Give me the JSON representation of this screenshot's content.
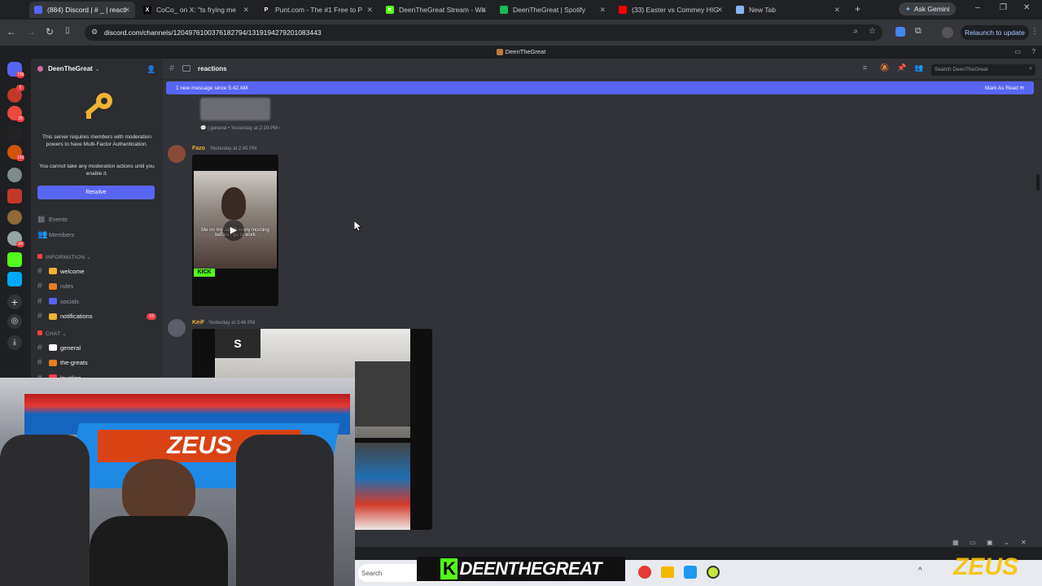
{
  "browser": {
    "tabs": [
      {
        "label": "(884) Discord | # _ | reacti",
        "favicon_color": "#5865f2",
        "favicon_glyph": "",
        "active": true
      },
      {
        "label": "CoCo_ on X: \"ts frying me",
        "favicon_color": "#000000",
        "favicon_glyph": "X",
        "active": false
      },
      {
        "label": "Punt.com - The #1 Free to P",
        "favicon_color": "#222222",
        "favicon_glyph": "P",
        "active": false
      },
      {
        "label": "DeenTheGreat Stream - Wa",
        "favicon_color": "#53fc18",
        "favicon_glyph": "K",
        "active": false
      },
      {
        "label": "DeenTheGreat | Spotify",
        "favicon_color": "#1db954",
        "favicon_glyph": "",
        "active": false
      },
      {
        "label": "(33) Easter vs Commey HIG",
        "favicon_color": "#ff0000",
        "favicon_glyph": "",
        "active": false
      },
      {
        "label": "New Tab",
        "favicon_color": "#8ab4f8",
        "favicon_glyph": "",
        "active": false
      }
    ],
    "new_tab_glyph": "+",
    "ask_gemini": "Ask Gemini",
    "url": "discord.com/channels/1204976100376182794/1319194279201083443",
    "relaunch": "Relaunch to update"
  },
  "discord": {
    "window_title": "DeenTheGreat",
    "server_name": "DeenTheGreat",
    "mfa_notice": "This server requires members with moderation powers to have Multi-Factor Authentication.",
    "mfa_sub": "You cannot take any moderation actions until you enable it.",
    "resolve_button": "Resolve",
    "nav_items": [
      "Events",
      "Members"
    ],
    "categories": [
      "INFORMATION",
      "CHAT"
    ],
    "info_channels": [
      {
        "name": "welcome",
        "emoji_color": "#f0b232",
        "bright": true
      },
      {
        "name": "rules",
        "emoji_color": "#e67e22",
        "bright": false
      },
      {
        "name": "socials",
        "emoji_color": "#5865f2",
        "bright": false
      },
      {
        "name": "notifications",
        "emoji_color": "#f0b232",
        "bright": true,
        "badge": "10"
      }
    ],
    "chat_channels": [
      {
        "name": "general",
        "emoji_color": "#ffffff",
        "bright": true
      },
      {
        "name": "the-greats",
        "emoji_color": "#e67e22",
        "bright": true
      },
      {
        "name": "leveling",
        "emoji_color": "#f23f43",
        "bright": true
      }
    ],
    "channel_name": "reactions",
    "search_placeholder": "Search DeenTheGreat",
    "new_message_banner": "1 new message since 5:42 AM",
    "mark_as_read": "Mark As Read",
    "reply_ref": {
      "channel": "general",
      "time": "Yesterday at 2:19 PM"
    },
    "messages": [
      {
        "user": "Fazo",
        "user_color": "#f0b232",
        "time": "Yesterday at 2:45 PM",
        "video_caption": "Me on my Jacob every morning before I go to work"
      },
      {
        "user": "KeiF",
        "user_color": "#f0b232",
        "time": "Yesterday at 3:46 PM"
      }
    ],
    "guild_badges": [
      "735",
      "6",
      "25",
      "160",
      "34"
    ]
  },
  "stream_overlay": {
    "watermark": "DEENTHEGREAT",
    "watermark_k": "K",
    "sponsor": "ZEUS",
    "taskbar_search": "Search"
  }
}
